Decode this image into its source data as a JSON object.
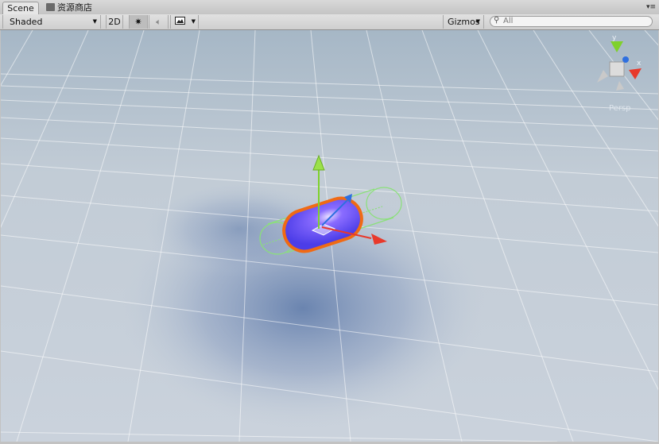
{
  "tabs": {
    "scene": "Scene",
    "asset_store": "资源商店"
  },
  "toolbar": {
    "draw_mode": "Shaded",
    "mode_2d": "2D",
    "lighting_icon": "sun-icon",
    "audio_icon": "speaker-icon",
    "effects_icon": "image-icon",
    "gizmos": "Gizmos",
    "search_placeholder": "All"
  },
  "viewport": {
    "projection_label": "Persp",
    "gizmo_axes": [
      "y",
      "x",
      "z"
    ]
  },
  "colors": {
    "x_axis": "#e8392b",
    "y_axis": "#7fd12b",
    "z_axis": "#2e6fe0",
    "selection_outline": "#f06a14",
    "collider": "#8be07a",
    "capsule": "#5b4cf2"
  }
}
